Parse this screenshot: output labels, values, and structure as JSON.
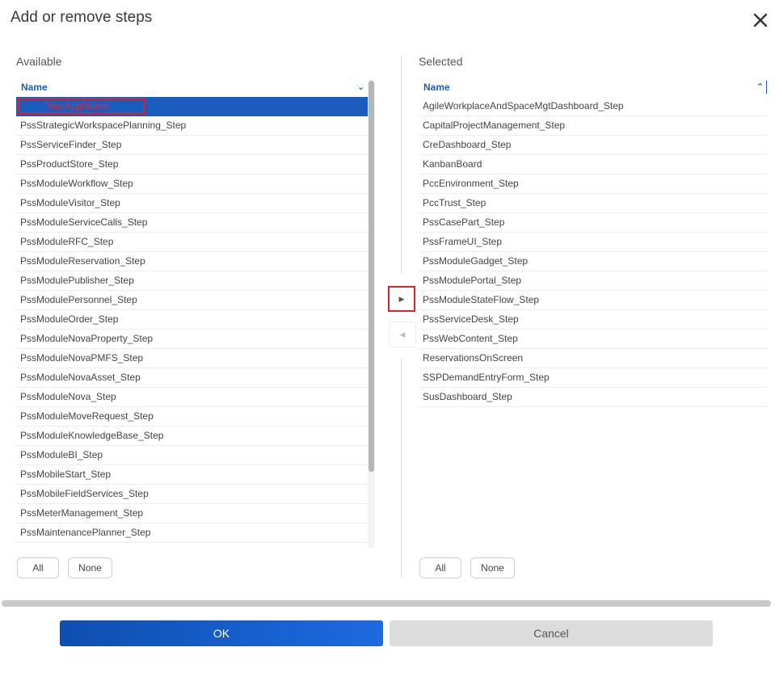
{
  "dialog": {
    "title": "Add or remove steps"
  },
  "available": {
    "label": "Available",
    "header": "Name",
    "selected_item": "YourAppName",
    "items": [
      "PssStrategicWorkspacePlanning_Step",
      "PssServiceFinder_Step",
      "PssProductStore_Step",
      "PssModuleWorkflow_Step",
      "PssModuleVisitor_Step",
      "PssModuleServiceCalls_Step",
      "PssModuleRFC_Step",
      "PssModuleReservation_Step",
      "PssModulePublisher_Step",
      "PssModulePersonnel_Step",
      "PssModuleOrder_Step",
      "PssModuleNovaProperty_Step",
      "PssModuleNovaPMFS_Step",
      "PssModuleNovaAsset_Step",
      "PssModuleNova_Step",
      "PssModuleMoveRequest_Step",
      "PssModuleKnowledgeBase_Step",
      "PssModuleBI_Step",
      "PssMobileStart_Step",
      "PssMobileFieldServices_Step",
      "PssMeterManagement_Step",
      "PssMaintenancePlanner_Step"
    ],
    "all_label": "All",
    "none_label": "None"
  },
  "selected": {
    "label": "Selected",
    "header": "Name",
    "items": [
      "AgileWorkplaceAndSpaceMgtDashboard_Step",
      "CapitalProjectManagement_Step",
      "CreDashboard_Step",
      "KanbanBoard",
      "PccEnvironment_Step",
      "PccTrust_Step",
      "PssCasePart_Step",
      "PssFrameUI_Step",
      "PssModuleGadget_Step",
      "PssModulePortal_Step",
      "PssModuleStateFlow_Step",
      "PssServiceDesk_Step",
      "PssWebContent_Step",
      "ReservationsOnScreen",
      "SSPDemandEntryForm_Step",
      "SusDashboard_Step"
    ],
    "all_label": "All",
    "none_label": "None"
  },
  "footer": {
    "ok_label": "OK",
    "cancel_label": "Cancel"
  },
  "icons": {
    "close": "close-icon",
    "move_right": "caret-right-icon",
    "move_left": "caret-left-icon",
    "sort_desc": "chevron-down-icon",
    "sort_asc": "chevron-up-icon"
  },
  "colors": {
    "accent": "#1a5dbf",
    "highlight_border": "#e0202a",
    "header_text": "#1f5fb3"
  }
}
